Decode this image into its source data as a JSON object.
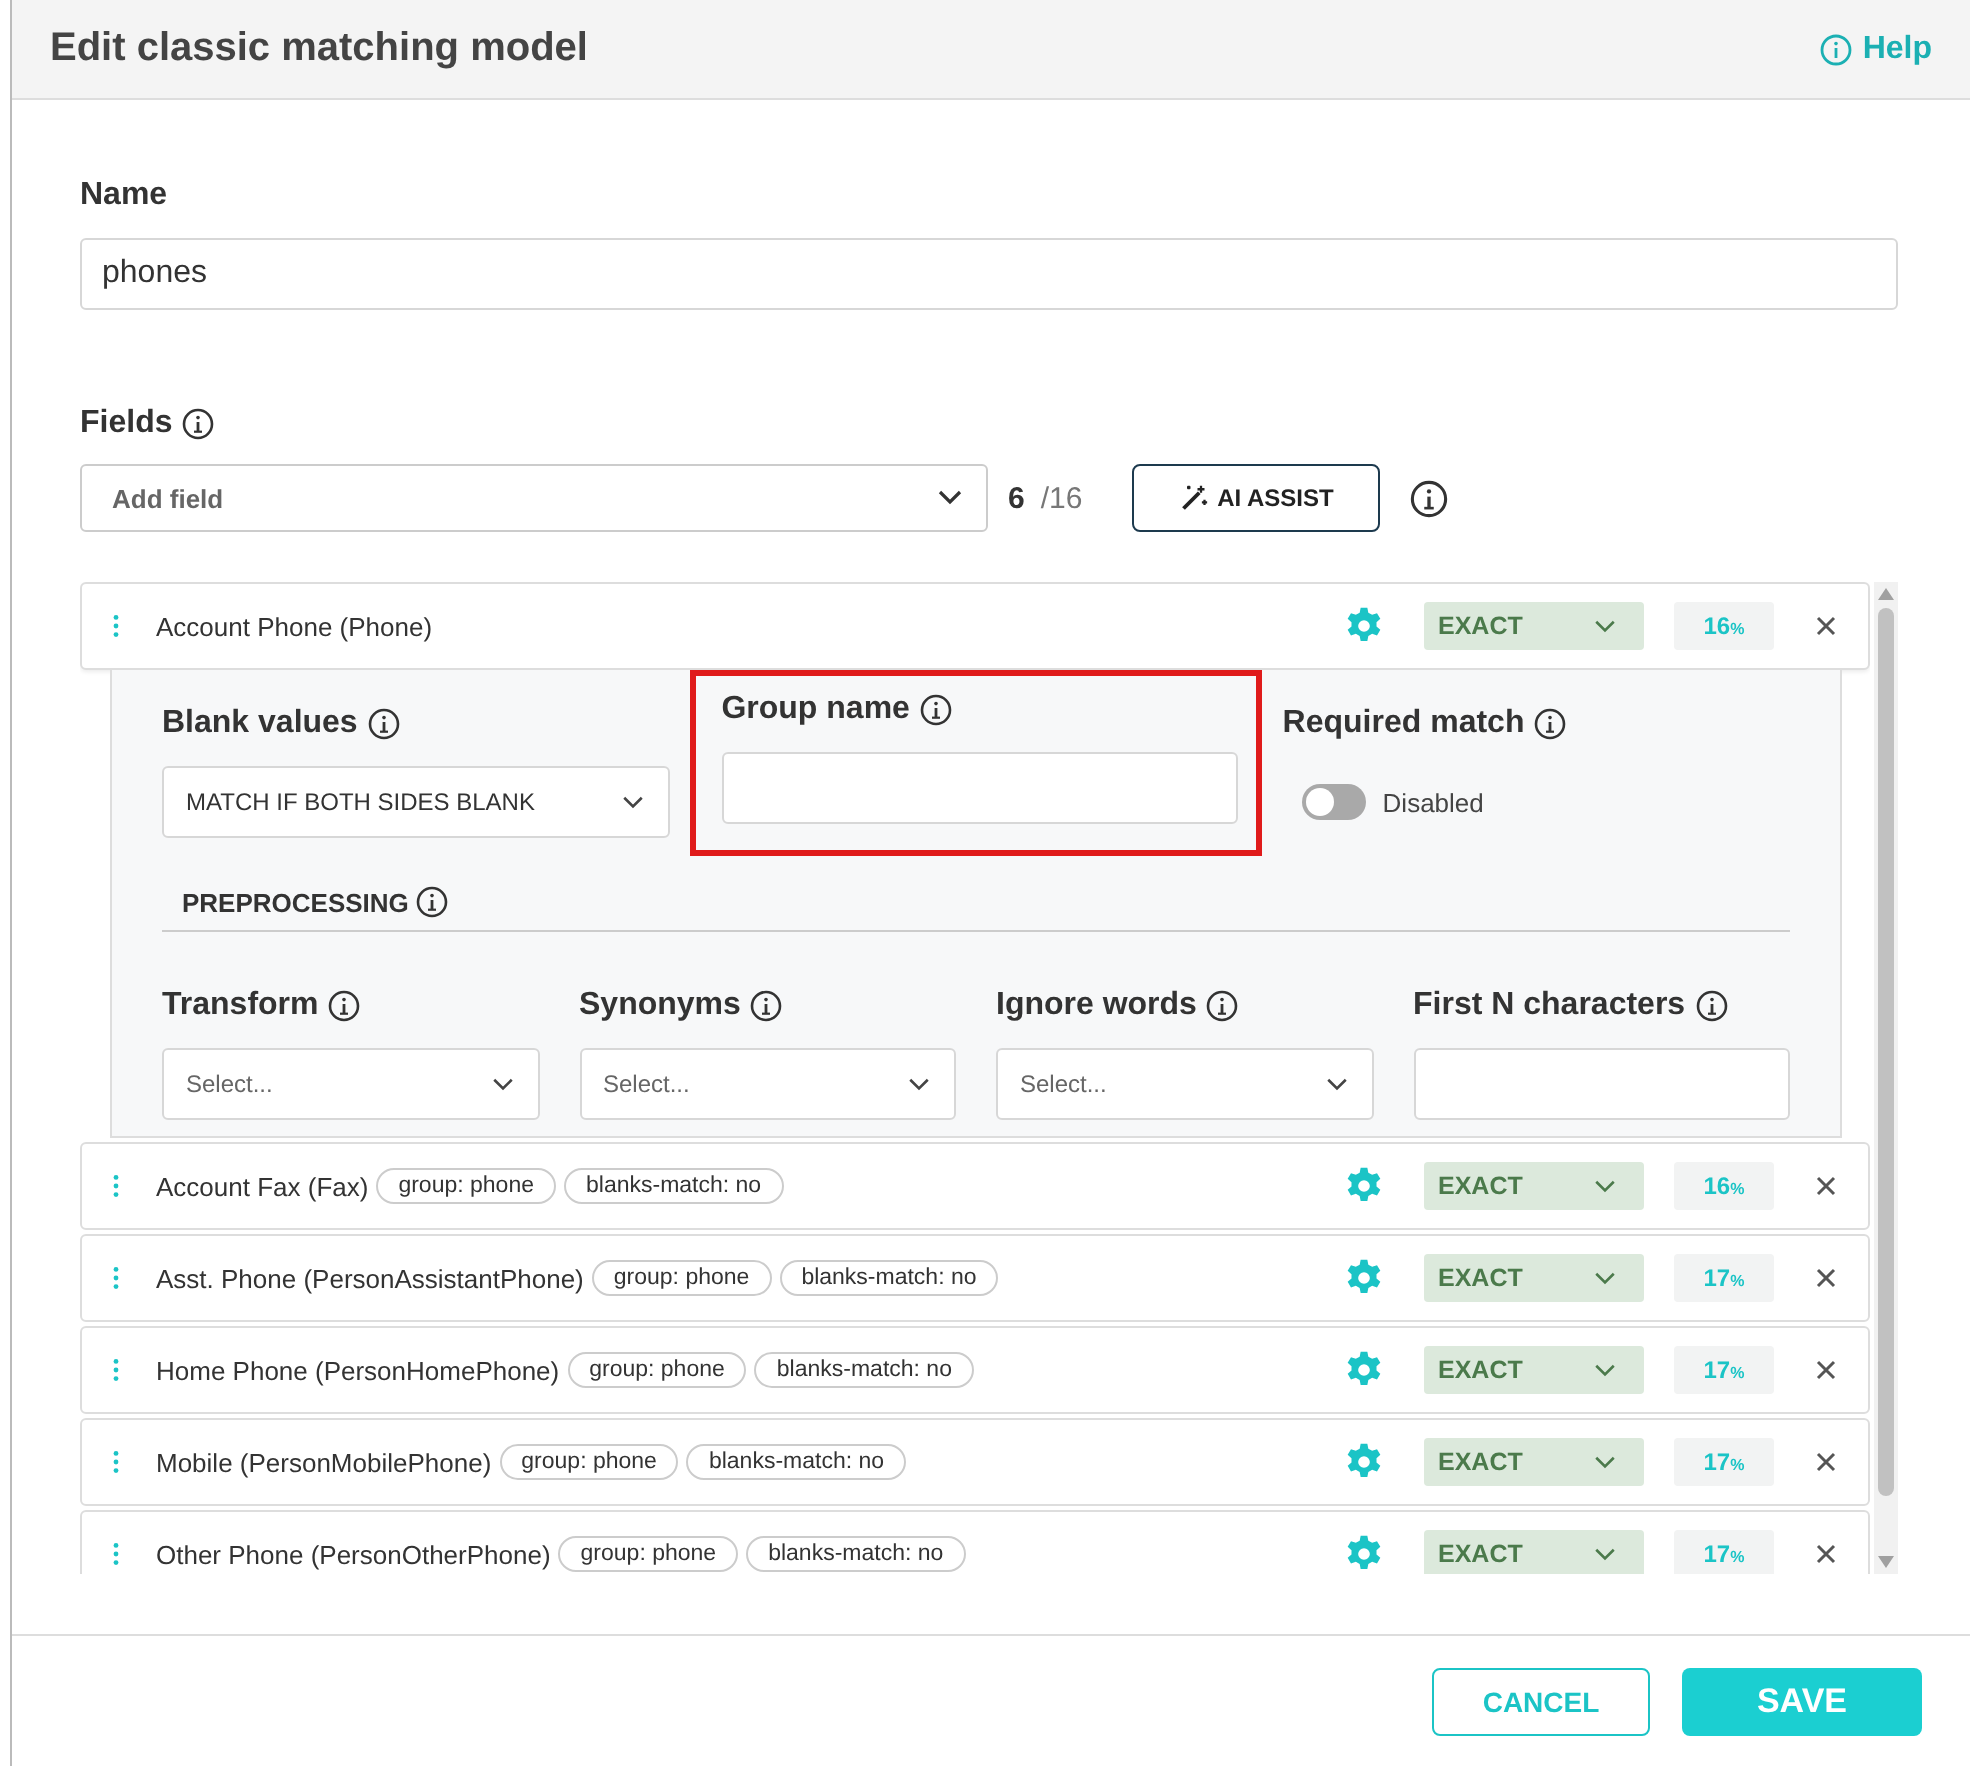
{
  "dialog": {
    "title": "Edit classic matching model",
    "help": "Help"
  },
  "name": {
    "label": "Name",
    "value": "phones"
  },
  "fields": {
    "label": "Fields",
    "add_field": {
      "placeholder": "Add field"
    },
    "count": "6",
    "total": "/16",
    "ai_assist": "AI ASSIST",
    "rows": [
      {
        "label": "Account Phone (Phone)",
        "tags": [],
        "expanded": true,
        "match": "EXACT",
        "weight": "16",
        "unit": "%",
        "details": {
          "blank_values": {
            "label": "Blank values",
            "value": "MATCH IF BOTH SIDES BLANK"
          },
          "group_name": {
            "label": "Group name",
            "highlighted": true
          },
          "required_match": {
            "label": "Required match",
            "on": false,
            "state_label": "Disabled"
          },
          "preprocessing": {
            "label": "PREPROCESSING",
            "filters": [
              {
                "kind": "select",
                "label": "Transform",
                "placeholder": "Select..."
              },
              {
                "kind": "select",
                "label": "Synonyms",
                "placeholder": "Select..."
              },
              {
                "kind": "select",
                "label": "Ignore words",
                "placeholder": "Select..."
              },
              {
                "kind": "input",
                "label": "First N characters"
              }
            ]
          }
        }
      },
      {
        "label": "Account Fax (Fax)",
        "tags": [
          "group: phone",
          "blanks-match: no"
        ],
        "expanded": false,
        "match": "EXACT",
        "weight": "16",
        "unit": "%"
      },
      {
        "label": "Asst. Phone (PersonAssistantPhone)",
        "tags": [
          "group: phone",
          "blanks-match: no"
        ],
        "expanded": false,
        "match": "EXACT",
        "weight": "17",
        "unit": "%"
      },
      {
        "label": "Home Phone (PersonHomePhone)",
        "tags": [
          "group: phone",
          "blanks-match: no"
        ],
        "expanded": false,
        "match": "EXACT",
        "weight": "17",
        "unit": "%"
      },
      {
        "label": "Mobile (PersonMobilePhone)",
        "tags": [
          "group: phone",
          "blanks-match: no"
        ],
        "expanded": false,
        "match": "EXACT",
        "weight": "17",
        "unit": "%"
      },
      {
        "label": "Other Phone (PersonOtherPhone)",
        "tags": [
          "group: phone",
          "blanks-match: no"
        ],
        "expanded": false,
        "match": "EXACT",
        "weight": "17",
        "unit": "%"
      }
    ]
  },
  "footer": {
    "cancel": "CANCEL",
    "save": "SAVE"
  }
}
